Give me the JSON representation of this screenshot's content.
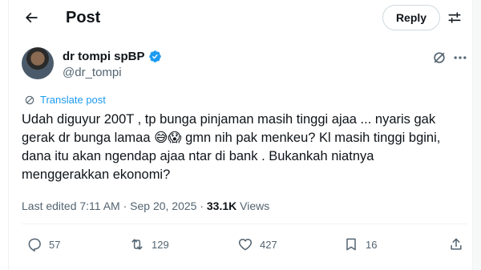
{
  "header": {
    "title": "Post",
    "back_icon": "arrow-left-icon",
    "reply_label": "Reply",
    "settings_icon": "sliders-icon"
  },
  "author": {
    "name": "dr tompi spBP",
    "handle": "@dr_tompi",
    "verified": true,
    "verified_color": "#1d9bf0"
  },
  "translate_label": "Translate post",
  "tweet": {
    "text": "Udah diguyur 200T , tp bunga pinjaman masih tinggi ajaa ... nyaris gak\ngerak dr bunga lamaa 😅😱 gmn nih pak menkeu? Kl masih tinggi bgini,\ndana itu akan ngendap ajaa ntar di bank . Bukankah niatnya\nmenggerakkan ekonomi?"
  },
  "meta": {
    "edited": "Last edited 7:11 AM · Sep 20, 2025 · ",
    "views_count": "33.1K",
    "views_label": " Views"
  },
  "actions": {
    "replies": "57",
    "reposts": "129",
    "likes": "427",
    "bookmarks": "16"
  },
  "colors": {
    "accent": "#1d9bf0",
    "text": "#0f1419",
    "secondary": "#536471"
  }
}
